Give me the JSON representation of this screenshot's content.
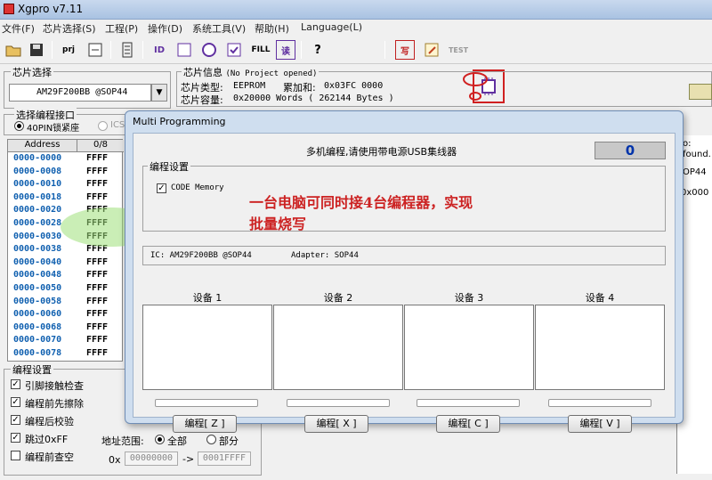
{
  "window": {
    "title": "Xgpro v7.11"
  },
  "menu": [
    "文件(F)",
    "芯片选择(S)",
    "工程(P)",
    "操作(D)",
    "系统工具(V)",
    "帮助(H)",
    "Language(L)"
  ],
  "toolbar": {
    "prj": "prj",
    "fill": "FILL",
    "help": "?",
    "write": "写",
    "read": "读",
    "test": "TEST"
  },
  "chip_select": {
    "label": "芯片选择",
    "value": "AM29F200BB   @SOP44"
  },
  "chip_info": {
    "label": "芯片信息",
    "note": "(No Project opened)",
    "type_label": "芯片类型:",
    "type_value": "EEPROM",
    "checksum_label": "累加和:",
    "checksum_value": "0x03FC 0000",
    "capacity_label": "芯片容量:",
    "capacity_value": "0x20000 Words ( 262144 Bytes )"
  },
  "interface": {
    "label": "选择编程接口",
    "opt1": "40PIN锁紧座",
    "opt2": "ICS"
  },
  "table": {
    "col_address": "Address",
    "col_data": "0/8",
    "rows": [
      {
        "addr": "0000-0000",
        "val": "FFFF"
      },
      {
        "addr": "0000-0008",
        "val": "FFFF"
      },
      {
        "addr": "0000-0010",
        "val": "FFFF"
      },
      {
        "addr": "0000-0018",
        "val": "FFFF"
      },
      {
        "addr": "0000-0020",
        "val": "FFFF"
      },
      {
        "addr": "0000-0028",
        "val": "FFFF"
      },
      {
        "addr": "0000-0030",
        "val": "FFFF"
      },
      {
        "addr": "0000-0038",
        "val": "FFFF"
      },
      {
        "addr": "0000-0040",
        "val": "FFFF"
      },
      {
        "addr": "0000-0048",
        "val": "FFFF"
      },
      {
        "addr": "0000-0050",
        "val": "FFFF"
      },
      {
        "addr": "0000-0058",
        "val": "FFFF"
      },
      {
        "addr": "0000-0060",
        "val": "FFFF"
      },
      {
        "addr": "0000-0068",
        "val": "FFFF"
      },
      {
        "addr": "0000-0070",
        "val": "FFFF"
      },
      {
        "addr": "0000-0078",
        "val": "FFFF"
      }
    ]
  },
  "prog_settings": {
    "label": "编程设置",
    "opt1": "引脚接触检查",
    "opt2": "编程前先擦除",
    "opt3": "编程后校验",
    "opt4": "跳过0xFF",
    "opt5": "编程前查空",
    "range_label": "地址范围:",
    "range_all": "全部",
    "range_part": "部分",
    "prefix": "0x",
    "start": "00000000",
    "arrow": "->",
    "end": "0001FFFF"
  },
  "right_panel": {
    "line1": "o:",
    "line2": "found.",
    "line3": "OP44",
    "line4": ": 0x000"
  },
  "dialog": {
    "title": "Multi Programming",
    "header": "多机编程,请使用带电源USB集线器",
    "counter": "0",
    "group_label": "编程设置",
    "code_memory": "CODE Memory",
    "annotation_line1": "一台电脑可同时接4台编程器，实现",
    "annotation_line2": "批量烧写",
    "ic_label": "IC: AM29F200BB  @SOP44",
    "adapter_label": "Adapter: SOP44",
    "devices": [
      "设备 1",
      "设备 2",
      "设备 3",
      "设备 4"
    ],
    "buttons": [
      "编程[ Z ]",
      "编程[ X ]",
      "编程[ C ]",
      "编程[ V ]"
    ]
  },
  "colors": {
    "annotation_red": "#cc2222",
    "address_blue": "#1060b0",
    "counter_blue": "#0033aa"
  }
}
